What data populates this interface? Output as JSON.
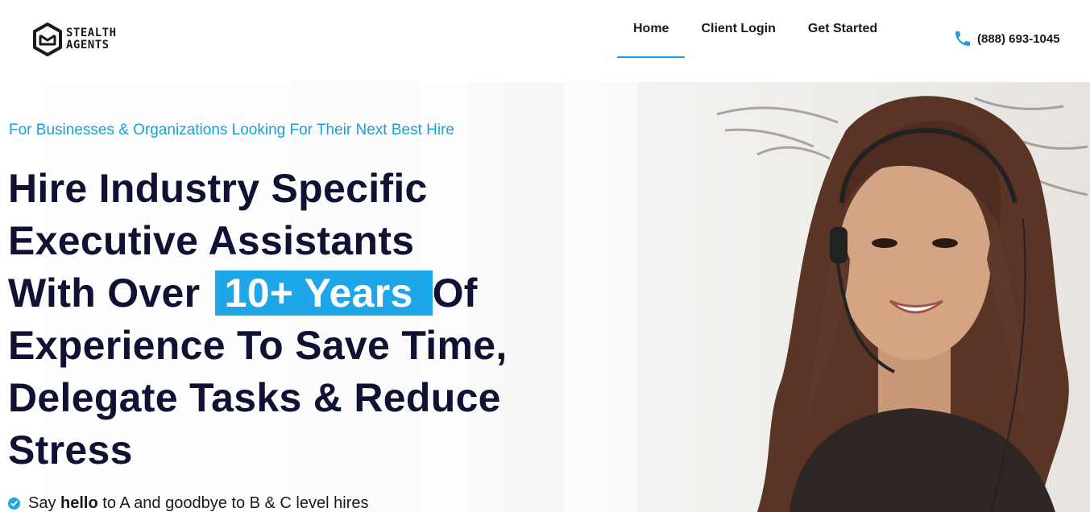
{
  "brand": {
    "line1": "STEALTH",
    "line2": "AGENTS",
    "logo_icon": "hexagon-envelope-logo"
  },
  "nav": {
    "items": [
      {
        "label": "Home",
        "active": true
      },
      {
        "label": "Client Login",
        "active": false
      },
      {
        "label": "Get Started",
        "active": false
      }
    ],
    "phone": "(888) 693-1045",
    "phone_icon": "phone-icon"
  },
  "hero": {
    "eyebrow": "For Businesses & Organizations Looking For Their Next Best Hire",
    "headline": {
      "line1": "Hire Industry Specific",
      "line2": "Executive Assistants",
      "line3_before": "With Over ",
      "line3_highlight": "10+ Years",
      "line3_after": "Of",
      "line4": "Experience To Save Time,",
      "line5": "Delegate Tasks & Reduce",
      "line6": "Stress"
    },
    "bullet": {
      "before": "Say ",
      "bold": "hello",
      "after": " to A and goodbye to B & C level hires"
    }
  },
  "colors": {
    "accent": "#1ea7e8",
    "eyebrow": "#16a0dc",
    "headline": "#0f1233",
    "nav_underline": "#1ea0dc"
  }
}
